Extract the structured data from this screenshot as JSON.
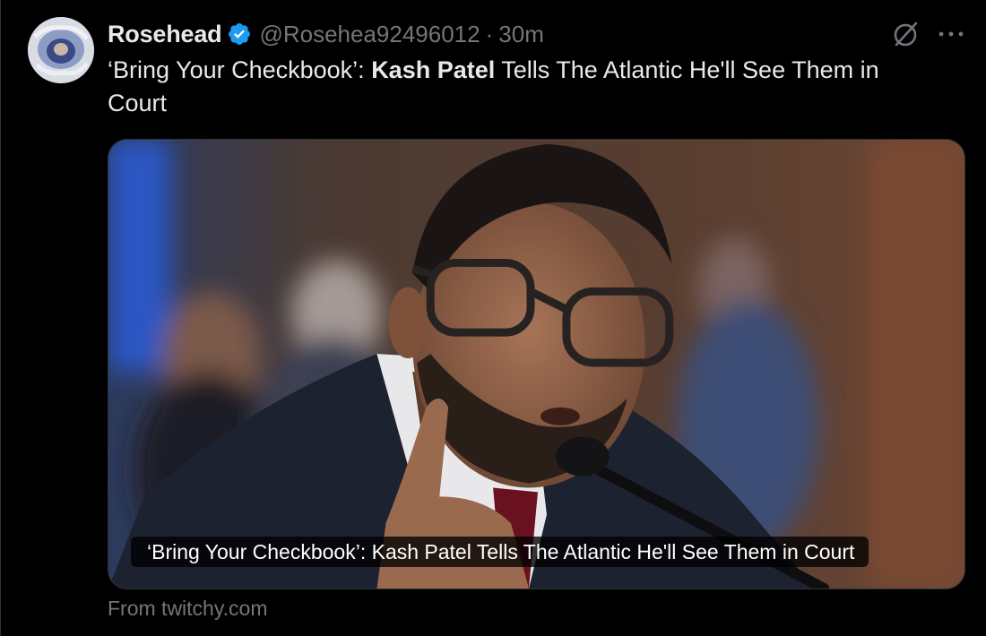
{
  "author": {
    "display_name": "Rosehead",
    "handle": "@Rosehea92496012",
    "separator": "·",
    "time": "30m",
    "verified": true
  },
  "tweet": {
    "text_part1": "‘Bring Your Checkbook’: ",
    "text_bold": "Kash Patel",
    "text_part2": " Tells The Atlantic He'll See Them in Court"
  },
  "card": {
    "caption": "‘Bring Your Checkbook’: Kash Patel Tells The Atlantic He'll See Them in Court",
    "source": "From twitchy.com"
  },
  "icons": {
    "verified": "verified-badge-icon",
    "grok": "grok-icon",
    "more": "more-icon"
  },
  "colors": {
    "background": "#000000",
    "text": "#e7e9ea",
    "muted": "#71767b",
    "verified": "#1d9bf0"
  }
}
